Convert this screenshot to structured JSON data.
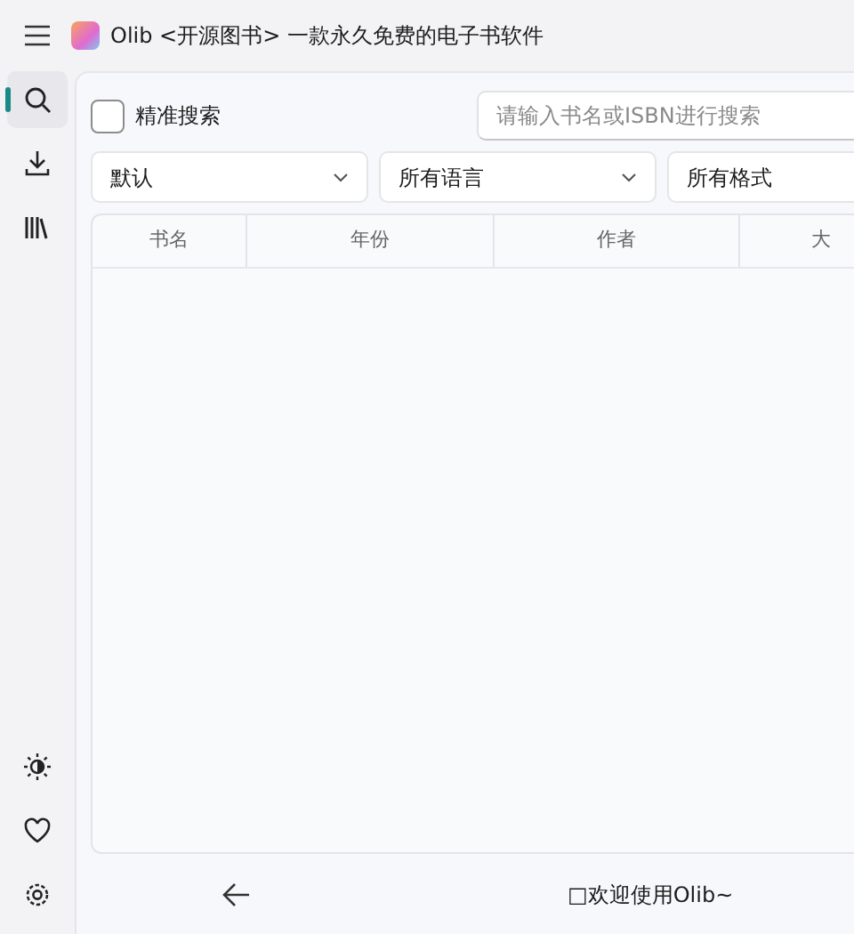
{
  "window": {
    "title": "Olib <开源图书> 一款永久免费的电子书软件"
  },
  "nav": [
    {
      "kind": "search",
      "selected": true
    },
    {
      "kind": "download",
      "selected": false
    },
    {
      "kind": "library",
      "selected": false
    }
  ],
  "nav_bottom": [
    {
      "kind": "theme"
    },
    {
      "kind": "heart"
    },
    {
      "kind": "settings"
    }
  ],
  "exact_search": {
    "label": "精准搜索",
    "checked": false
  },
  "search": {
    "placeholder": "请输入书名或ISBN进行搜索"
  },
  "filters": [
    "默认",
    "所有语言",
    "所有格式"
  ],
  "table": {
    "columns": [
      "书名",
      "年份",
      "作者",
      "大"
    ]
  },
  "status": {
    "message": "□欢迎使用Olib~"
  }
}
